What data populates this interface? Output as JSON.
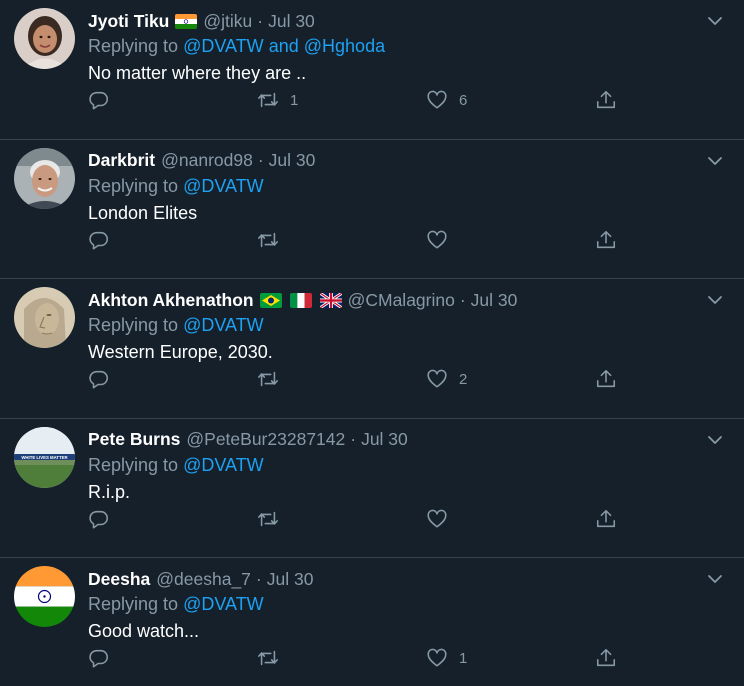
{
  "colors": {
    "background": "#15202b",
    "divider": "#38444d",
    "secondary_text": "#8899a6",
    "link": "#1da1f2",
    "primary_text": "#ffffff"
  },
  "icons": {
    "reply": "reply-icon",
    "retweet": "retweet-icon",
    "like": "heart-icon",
    "share": "share-icon",
    "more": "chevron-down-icon"
  },
  "tweets": [
    {
      "name": "Jyoti Tiku",
      "flags": [
        "india"
      ],
      "handle": "@jtiku",
      "separator": "·",
      "time": "Jul 30",
      "replying_prefix": "Replying to",
      "replying_to_1": "@DVATW",
      "replying_joiner": "and",
      "replying_to_2": "@Hghoda",
      "text": "No matter where they are ..",
      "retweets": "1",
      "likes": "6"
    },
    {
      "name": "Darkbrit",
      "flags": [],
      "handle": "@nanrod98",
      "separator": "·",
      "time": "Jul 30",
      "replying_prefix": "Replying to",
      "replying_to_1": "@DVATW",
      "text": "London Elites",
      "retweets": "",
      "likes": ""
    },
    {
      "name": "Akhton Akhenathon",
      "flags": [
        "brazil",
        "italy",
        "uk"
      ],
      "handle": "@CMalagrino",
      "separator": "·",
      "time": "Jul 30",
      "replying_prefix": "Replying to",
      "replying_to_1": "@DVATW",
      "text": "Western Europe, 2030.",
      "retweets": "",
      "likes": "2"
    },
    {
      "name": "Pete Burns",
      "flags": [],
      "handle": "@PeteBur23287142",
      "separator": "·",
      "time": "Jul 30",
      "replying_prefix": "Replying to",
      "replying_to_1": "@DVATW",
      "text": "R.i.p.",
      "retweets": "",
      "likes": "",
      "avatar_banner": "WHITE LIVES MATTER"
    },
    {
      "name": "Deesha",
      "flags": [],
      "handle": "@deesha_7",
      "separator": "·",
      "time": "Jul 30",
      "replying_prefix": "Replying to",
      "replying_to_1": "@DVATW",
      "text": "Good watch...",
      "retweets": "",
      "likes": "1"
    }
  ]
}
